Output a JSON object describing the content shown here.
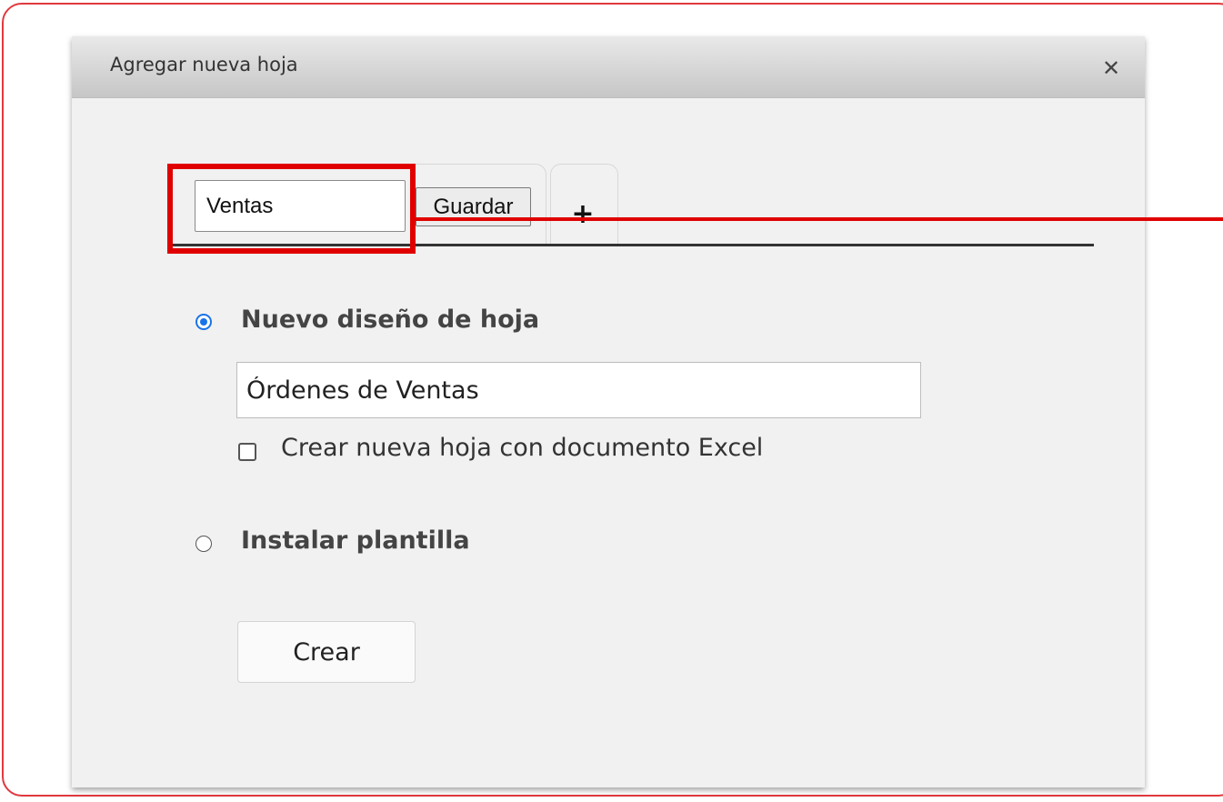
{
  "dialog": {
    "title": "Agregar nueva hoja",
    "close_icon": "close-icon"
  },
  "tabs": {
    "sheet_name_value": "Ventas",
    "save_label": "Guardar",
    "add_label": "+"
  },
  "options": {
    "new_design": {
      "label": "Nuevo diseño de hoja",
      "selected": true,
      "name_value": "Órdenes de Ventas",
      "excel_checkbox_label": "Crear nueva hoja con documento Excel",
      "excel_checked": false
    },
    "template": {
      "label": "Instalar plantilla",
      "selected": false
    }
  },
  "actions": {
    "create_label": "Crear"
  },
  "colors": {
    "annotation": "#e00000",
    "frame": "#e0393e",
    "radio_accent": "#1a73e8"
  }
}
